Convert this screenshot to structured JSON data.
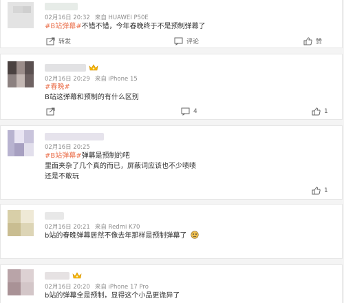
{
  "comments": [
    {
      "date": "02月16日 20:32",
      "device": "来自 HUAWEI P50E",
      "segments": [
        {
          "text": "#B站弹幕#",
          "tag": true
        },
        {
          "text": "不错不错，今年春晚终于不是预制弹幕了",
          "tag": false
        }
      ],
      "forward_label": "转发",
      "comment_label": "评论",
      "like_count": "",
      "reply_count": ""
    },
    {
      "date": "02月16日 20:29",
      "device": "来自 iPhone 15",
      "tag_line": "#春晚#",
      "line1": "B站这弹幕和预制的有什么区别",
      "reply_count": "4",
      "like_count": "1"
    },
    {
      "date": "02月16日 20:25",
      "segments": [
        {
          "text": "#B站弹幕#",
          "tag": true
        },
        {
          "text": "弹幕是预制的吧",
          "tag": false
        }
      ],
      "line2": "里面夹杂了几个真的而已，屏蔽词应该也不少啧啧",
      "line3": "还是不敢玩",
      "like_count": "1"
    },
    {
      "date": "02月16日 20:21",
      "device": "来自 Redmi K70",
      "line1": "b站的春晚弹幕居然不像去年那样是预制弹幕了"
    },
    {
      "date": "02月16日 20:20",
      "device": "来自 iPhone 17 Pro",
      "line1": "b站的弹幕全是预制，显得这个小品更诡异了"
    }
  ],
  "colors": {
    "tag": "#eb7350",
    "meta": "#8c8c8c",
    "gold": "#f5b400"
  }
}
